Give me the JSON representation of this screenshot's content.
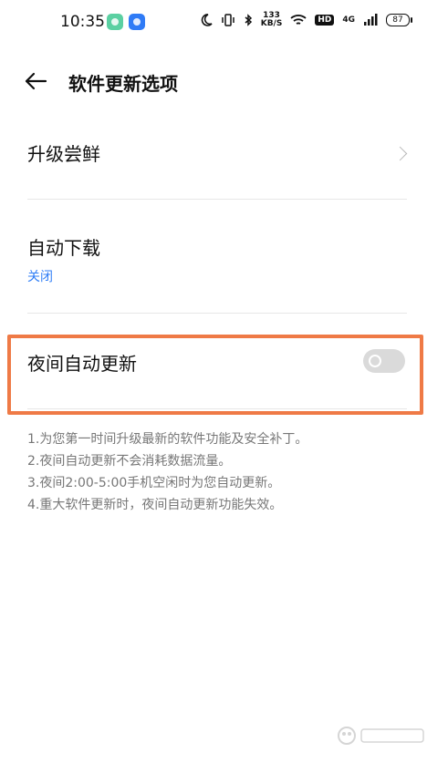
{
  "status_bar": {
    "time": "10:35",
    "network_speed_top": "133",
    "network_speed_bottom": "KB/S",
    "hd": "HD",
    "cell": "4G",
    "battery": "87",
    "icons": [
      "moon-icon",
      "vibrate-icon",
      "bluetooth-icon",
      "wifi-icon",
      "signal-icon"
    ]
  },
  "header": {
    "title": "软件更新选项",
    "back_icon": "arrow-left-icon"
  },
  "settings": {
    "item_1": {
      "label": "升级尝鲜"
    },
    "item_2": {
      "label": "自动下载",
      "value": "关闭"
    },
    "item_3": {
      "label": "夜间自动更新",
      "toggle_on": false
    }
  },
  "notes": [
    "1.为您第一时间升级最新的软件功能及安全补丁。",
    "2.夜间自动更新不会消耗数据流量。",
    "3.夜间2:00-5:00手机空闲时为您自动更新。",
    "4.重大软件更新时，夜间自动更新功能失效。"
  ],
  "colors": {
    "accent": "#2f7df6",
    "highlight_border": "#ef7a46",
    "toggle_off": "#dadada"
  }
}
